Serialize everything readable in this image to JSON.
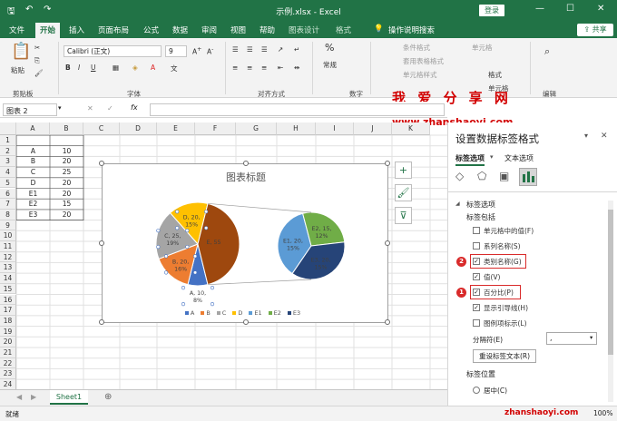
{
  "titlebar": {
    "filename": "示例.xlsx",
    "app": "Excel",
    "login": "登录"
  },
  "tabs": [
    "文件",
    "开始",
    "插入",
    "页面布局",
    "公式",
    "数据",
    "审阅",
    "视图",
    "帮助",
    "图表设计",
    "格式"
  ],
  "tell_me": "操作说明搜索",
  "share": "共享",
  "ribbon": {
    "paste": "粘贴",
    "groups": {
      "clipboard": "剪贴板",
      "font": "字体",
      "alignment": "对齐方式",
      "number": "数字",
      "cells": "单元格",
      "editing": "编辑"
    },
    "font_name": "Calibri (正文)",
    "font_size": "9",
    "number_format": "常规",
    "cond_format": "条件格式",
    "table_format": "套用表格格式",
    "cell_style": "单元格样式",
    "cells_btn": "单元格",
    "format_btn": "格式"
  },
  "watermark": {
    "title": "我 爱 分 享 网",
    "url": "www.zhanshaoyi.com",
    "footer": "zhanshaoyi.com"
  },
  "namebox": "图表 2",
  "columns": [
    "A",
    "B",
    "C",
    "D",
    "E",
    "F",
    "G",
    "H",
    "I",
    "J",
    "K"
  ],
  "rows": [
    "1",
    "2",
    "3",
    "4",
    "5",
    "6",
    "7",
    "8",
    "9",
    "10",
    "11",
    "12",
    "13",
    "14",
    "15",
    "16",
    "17",
    "18",
    "19",
    "20",
    "21",
    "22",
    "23",
    "24"
  ],
  "table": [
    [
      "A",
      "10"
    ],
    [
      "B",
      "20"
    ],
    [
      "C",
      "25"
    ],
    [
      "D",
      "20"
    ],
    [
      "E1",
      "20"
    ],
    [
      "E2",
      "15"
    ],
    [
      "E3",
      "20"
    ]
  ],
  "chart": {
    "title": "图表标题",
    "labels": [
      "A, 10, 8%",
      "B, 20, 16%",
      "C, 25, 19%",
      "D, 20, 15%",
      "E, 55",
      "E1, 20, 15%",
      "E2, 15, 12%",
      "E3, 20, 15%"
    ],
    "legend": [
      "A",
      "B",
      "C",
      "D",
      "E1",
      "E2",
      "E3"
    ]
  },
  "chart_data": {
    "type": "pie",
    "subtype": "pie-of-pie",
    "categories": [
      "A",
      "B",
      "C",
      "D",
      "E1",
      "E2",
      "E3"
    ],
    "values": [
      10,
      20,
      25,
      20,
      20,
      15,
      20
    ],
    "percent": [
      8,
      16,
      19,
      15,
      15,
      12,
      15
    ],
    "colors": [
      "#4472c4",
      "#ed7d31",
      "#a5a5a5",
      "#ffc000",
      "#5b9bd5",
      "#70ad47",
      "#264478"
    ],
    "other_color": "#9e480e",
    "title": "图表标题",
    "legend": "bottom"
  },
  "sheet_tab": "Sheet1",
  "status": {
    "ready": "就绪",
    "zoom": "100%"
  },
  "pane": {
    "title": "设置数据标签格式",
    "tab_label_options": "标签选项",
    "tab_text_options": "文本选项",
    "section": "标签选项",
    "contains": "标签包括",
    "options": [
      {
        "label": "单元格中的值(F)",
        "checked": false
      },
      {
        "label": "系列名称(S)",
        "checked": false
      },
      {
        "label": "类别名称(G)",
        "checked": true
      },
      {
        "label": "值(V)",
        "checked": true
      },
      {
        "label": "百分比(P)",
        "checked": true
      },
      {
        "label": "显示引导线(H)",
        "checked": true
      },
      {
        "label": "图例项标示(L)",
        "checked": false
      }
    ],
    "separator_label": "分隔符(E)",
    "separator_value": ",",
    "reset_button": "重设标签文本(R)",
    "position_label": "标签位置",
    "position_center": "居中(C)",
    "markers": [
      "2",
      "1"
    ],
    "check_mark": "✓"
  }
}
